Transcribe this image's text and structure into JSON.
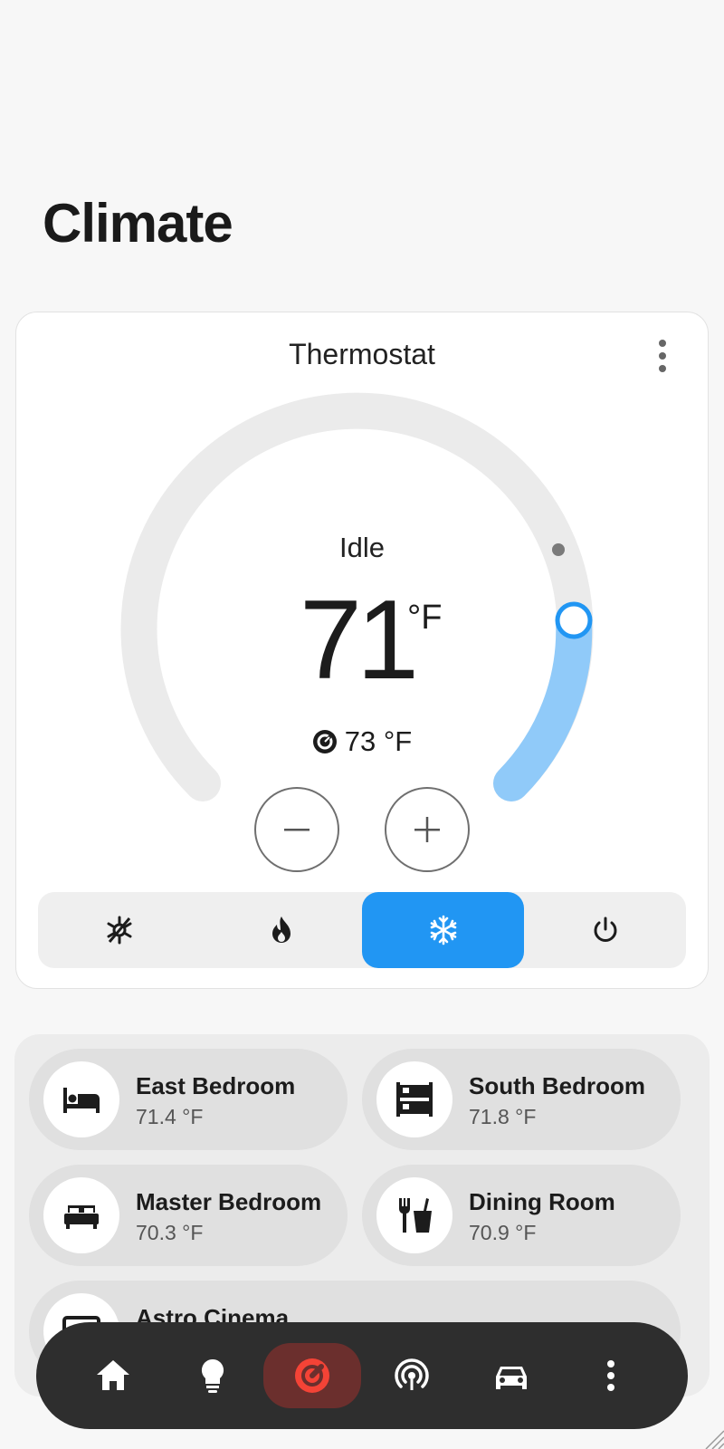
{
  "page": {
    "title": "Climate"
  },
  "thermostat": {
    "title": "Thermostat",
    "state": "Idle",
    "target_temp": "71",
    "target_unit": "°F",
    "current_temp": "73 °F",
    "setpoint_range": {
      "min": 45,
      "max": 95
    },
    "active_mode": "cool",
    "modes": [
      {
        "name": "heat_cool",
        "icon": "sun-snowflake-icon"
      },
      {
        "name": "heat",
        "icon": "fire-icon"
      },
      {
        "name": "cool",
        "icon": "snowflake-icon"
      },
      {
        "name": "off",
        "icon": "power-icon"
      }
    ],
    "colors": {
      "cool": "#2196f3",
      "arc_fill": "#90caf9",
      "track": "#ebebeb"
    }
  },
  "areas": [
    {
      "name": "East Bedroom",
      "temp": "71.4 °F",
      "icon": "bed-icon"
    },
    {
      "name": "South Bedroom",
      "temp": "71.8 °F",
      "icon": "bunk-bed-icon"
    },
    {
      "name": "Master Bedroom",
      "temp": "70.3 °F",
      "icon": "double-bed-icon"
    },
    {
      "name": "Dining Room",
      "temp": "70.9 °F",
      "icon": "food-drink-icon"
    },
    {
      "name": "Astro Cinema",
      "temp": "",
      "icon": "tv-icon"
    }
  ],
  "nav": {
    "active": "climate",
    "items": [
      "home-icon",
      "lightbulb-icon",
      "thermostat-icon",
      "broadcast-icon",
      "car-icon",
      "more-vertical-icon"
    ],
    "active_color": "#f44336"
  }
}
